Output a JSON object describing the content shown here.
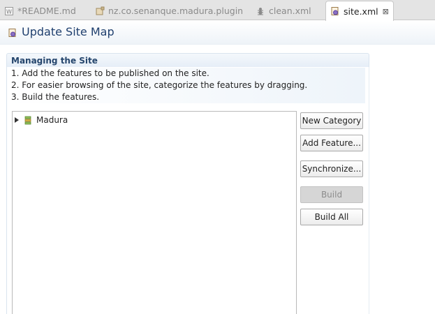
{
  "tabs": [
    {
      "label": "*README.md",
      "icon": "markdown-file-icon"
    },
    {
      "label": "nz.co.senanque.madura.plugin",
      "icon": "plugin-icon"
    },
    {
      "label": "clean.xml",
      "icon": "ant-file-icon"
    },
    {
      "label": "site.xml",
      "icon": "site-file-icon",
      "active": true,
      "close": "⊠"
    }
  ],
  "page": {
    "title": "Update Site Map"
  },
  "section": {
    "title": "Managing the Site",
    "steps": [
      "1. Add the features to be published on the site.",
      "2. For easier browsing of the site, categorize the features by dragging.",
      "3. Build the features."
    ]
  },
  "tree": {
    "items": [
      {
        "label": "Madura"
      }
    ]
  },
  "buttons": {
    "new_category": "New Category",
    "add_feature": "Add Feature...",
    "synchronize": "Synchronize...",
    "build": "Build",
    "build_all": "Build All"
  }
}
